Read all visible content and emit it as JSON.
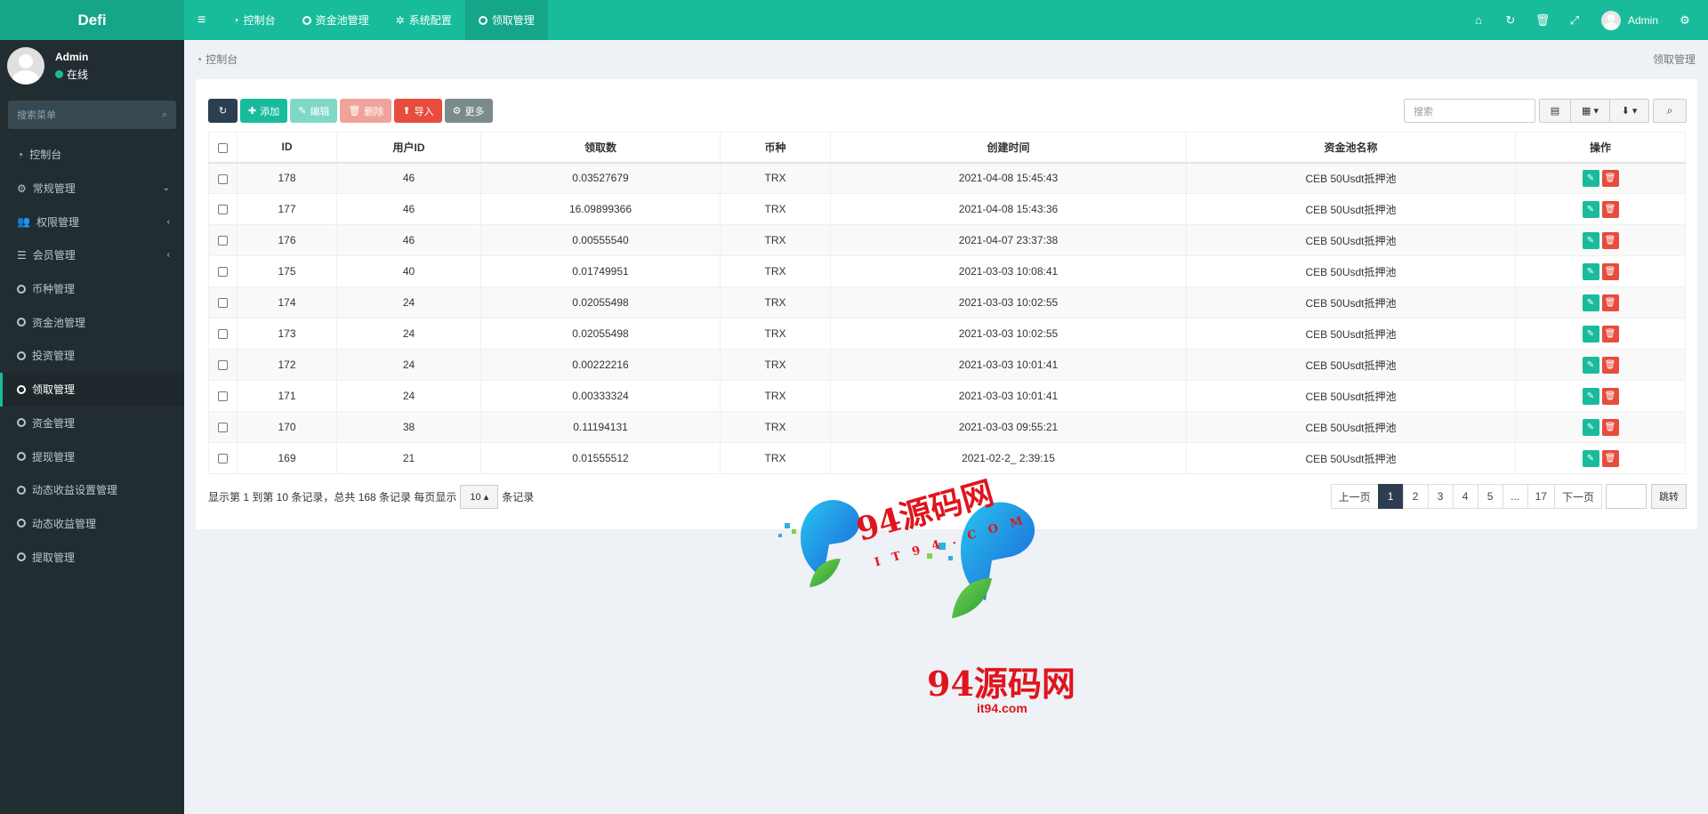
{
  "app": {
    "logo": "Defi"
  },
  "topnav": {
    "tabs": [
      {
        "label": "控制台",
        "icon": "dashboard-icon"
      },
      {
        "label": "资金池管理",
        "icon": "circle-icon"
      },
      {
        "label": "系统配置",
        "icon": "gear-icon"
      },
      {
        "label": "领取管理",
        "icon": "circle-icon",
        "active": true
      }
    ],
    "user": "Admin"
  },
  "sidebar": {
    "user": {
      "name": "Admin",
      "status": "在线"
    },
    "search_placeholder": "搜索菜单",
    "items": [
      {
        "label": "控制台",
        "icon": "dashboard-icon"
      },
      {
        "label": "常规管理",
        "icon": "cogs-icon",
        "caret": "⌄"
      },
      {
        "label": "权限管理",
        "icon": "group-icon",
        "caret": "‹"
      },
      {
        "label": "会员管理",
        "icon": "list-icon",
        "caret": "‹"
      },
      {
        "label": "币种管理",
        "icon": "circle-icon"
      },
      {
        "label": "资金池管理",
        "icon": "circle-icon"
      },
      {
        "label": "投资管理",
        "icon": "circle-icon"
      },
      {
        "label": "领取管理",
        "icon": "circle-icon",
        "active": true
      },
      {
        "label": "资金管理",
        "icon": "circle-icon"
      },
      {
        "label": "提现管理",
        "icon": "circle-icon"
      },
      {
        "label": "动态收益设置管理",
        "icon": "circle-icon"
      },
      {
        "label": "动态收益管理",
        "icon": "circle-icon"
      },
      {
        "label": "提取管理",
        "icon": "circle-icon"
      }
    ]
  },
  "breadcrumb": {
    "home": "控制台",
    "current": "领取管理"
  },
  "toolbar": {
    "add": "添加",
    "edit": "编辑",
    "delete": "删除",
    "import": "导入",
    "more": "更多",
    "search_placeholder": "搜索"
  },
  "table": {
    "headers": [
      "ID",
      "用户ID",
      "领取数",
      "币种",
      "创建时间",
      "资金池名称",
      "操作"
    ],
    "rows": [
      [
        "178",
        "46",
        "0.03527679",
        "TRX",
        "2021-04-08 15:45:43",
        "CEB 50Usdt抵押池"
      ],
      [
        "177",
        "46",
        "16.09899366",
        "TRX",
        "2021-04-08 15:43:36",
        "CEB 50Usdt抵押池"
      ],
      [
        "176",
        "46",
        "0.00555540",
        "TRX",
        "2021-04-07 23:37:38",
        "CEB 50Usdt抵押池"
      ],
      [
        "175",
        "40",
        "0.01749951",
        "TRX",
        "2021-03-03 10:08:41",
        "CEB 50Usdt抵押池"
      ],
      [
        "174",
        "24",
        "0.02055498",
        "TRX",
        "2021-03-03 10:02:55",
        "CEB 50Usdt抵押池"
      ],
      [
        "173",
        "24",
        "0.02055498",
        "TRX",
        "2021-03-03 10:02:55",
        "CEB 50Usdt抵押池"
      ],
      [
        "172",
        "24",
        "0.00222216",
        "TRX",
        "2021-03-03 10:01:41",
        "CEB 50Usdt抵押池"
      ],
      [
        "171",
        "24",
        "0.00333324",
        "TRX",
        "2021-03-03 10:01:41",
        "CEB 50Usdt抵押池"
      ],
      [
        "170",
        "38",
        "0.11194131",
        "TRX",
        "2021-03-03 09:55:21",
        "CEB 50Usdt抵押池"
      ],
      [
        "169",
        "21",
        "0.01555512",
        "TRX",
        "2021-02-2_ 2:39:15",
        "CEB 50Usdt抵押池"
      ]
    ]
  },
  "footer": {
    "info": "显示第 1 到第 10 条记录，总共 168 条记录 每页显示",
    "page_size": "10",
    "suffix": "条记录"
  },
  "pager": {
    "prev": "上一页",
    "pages": [
      "1",
      "2",
      "3",
      "4",
      "5",
      "...",
      "17"
    ],
    "next": "下一页",
    "go": "跳转",
    "current": "1"
  },
  "watermark": {
    "brand": "94源码网",
    "domain": "it94.com",
    "tagline": "IT94.COM"
  },
  "colors": {
    "primary": "#18bc9c",
    "sidebar": "#222d32",
    "danger": "#e74c3c",
    "dark": "#2c3e50"
  }
}
